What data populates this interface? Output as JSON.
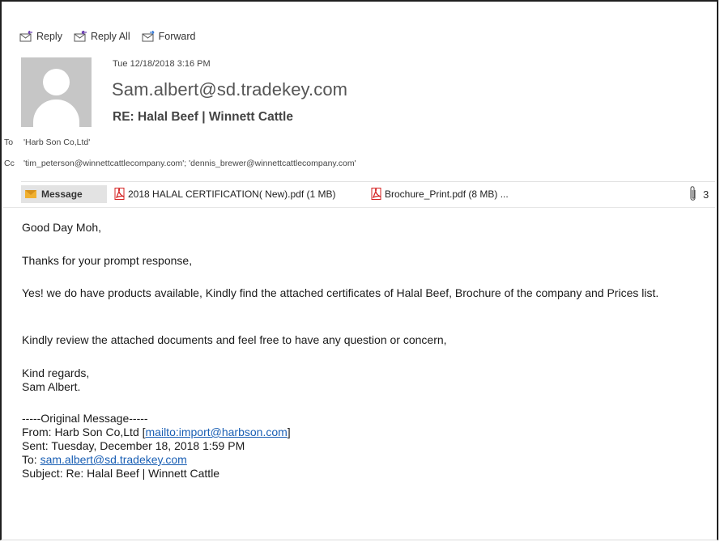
{
  "toolbar": {
    "reply": "Reply",
    "reply_all": "Reply All",
    "forward": "Forward"
  },
  "header": {
    "date": "Tue 12/18/2018 3:16 PM",
    "from": "Sam.albert@sd.tradekey.com",
    "subject": "RE: Halal Beef | Winnett Cattle",
    "to_label": "To",
    "to_value": "'Harb Son Co,Ltd'",
    "cc_label": "Cc",
    "cc_value": "'tim_peterson@winnettcattlecompany.com'; 'dennis_brewer@winnettcattlecompany.com'"
  },
  "attachments": {
    "message_tab": "Message",
    "items": [
      {
        "name": "2018 HALAL CERTIFICATION( New).pdf (1 MB)"
      },
      {
        "name": "Brochure_Print.pdf (8 MB)  ..."
      }
    ],
    "count": "3"
  },
  "body": {
    "greeting": "Good Day Moh,",
    "line1": "Thanks for your prompt response,",
    "line2": "Yes! we do have products available, Kindly find the attached certificates of Halal Beef, Brochure of the company and Prices list.",
    "line3": "Kindly review the attached documents and feel free to have any question or concern,",
    "closing1": "Kind regards,",
    "closing2": "Sam Albert.",
    "orig_header": "-----Original Message-----",
    "orig_from_prefix": "From: Harb Son Co,Ltd [",
    "orig_from_link": "mailto:import@harbson.com",
    "orig_from_suffix": "]",
    "orig_sent": "Sent: Tuesday, December 18, 2018 1:59 PM",
    "orig_to_prefix": "To: ",
    "orig_to_link": "sam.albert@sd.tradekey.com",
    "orig_subject": "Subject: Re: Halal Beef | Winnett Cattle"
  },
  "colors": {
    "link": "#1a5fb4",
    "pdf_red": "#d42020",
    "avatar_bg": "#c6c6c6"
  }
}
